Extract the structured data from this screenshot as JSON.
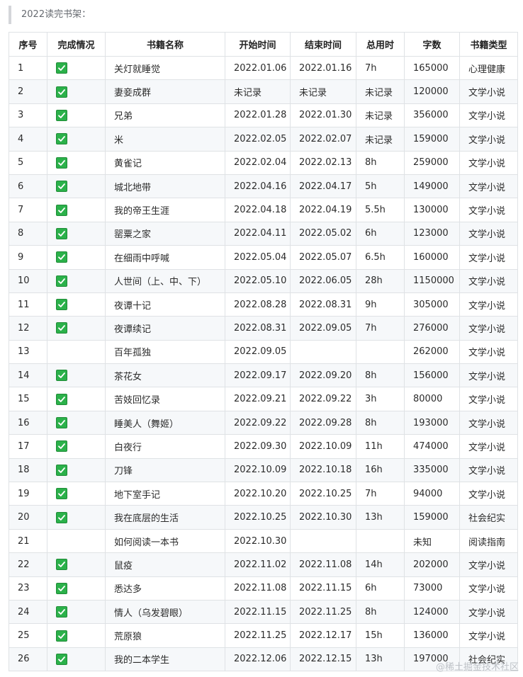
{
  "heading": "2022读完书架：",
  "columns": [
    "序号",
    "完成情况",
    "书籍名称",
    "开始时间",
    "结束时间",
    "总用时",
    "字数",
    "书籍类型"
  ],
  "rows": [
    {
      "no": "1",
      "done": true,
      "title": "关灯就睡觉",
      "start": "2022.01.06",
      "end": "2022.01.16",
      "time": "7h",
      "words": "165000",
      "type": "心理健康"
    },
    {
      "no": "2",
      "done": true,
      "title": "妻妾成群",
      "start": "未记录",
      "end": "未记录",
      "time": "未记录",
      "words": "120000",
      "type": "文学小说"
    },
    {
      "no": "3",
      "done": true,
      "title": "兄弟",
      "start": "2022.01.28",
      "end": "2022.01.30",
      "time": "未记录",
      "words": "356000",
      "type": "文学小说"
    },
    {
      "no": "4",
      "done": true,
      "title": "米",
      "start": "2022.02.05",
      "end": "2022.02.07",
      "time": "未记录",
      "words": "159000",
      "type": "文学小说"
    },
    {
      "no": "5",
      "done": true,
      "title": "黄雀记",
      "start": "2022.02.04",
      "end": "2022.02.13",
      "time": "8h",
      "words": "259000",
      "type": "文学小说"
    },
    {
      "no": "6",
      "done": true,
      "title": "城北地带",
      "start": "2022.04.16",
      "end": "2022.04.17",
      "time": "5h",
      "words": "149000",
      "type": "文学小说"
    },
    {
      "no": "7",
      "done": true,
      "title": "我的帝王生涯",
      "start": "2022.04.18",
      "end": "2022.04.19",
      "time": "5.5h",
      "words": "130000",
      "type": "文学小说"
    },
    {
      "no": "8",
      "done": true,
      "title": "罂粟之家",
      "start": "2022.04.11",
      "end": "2022.05.02",
      "time": "6h",
      "words": "123000",
      "type": "文学小说"
    },
    {
      "no": "9",
      "done": true,
      "title": "在细雨中呼喊",
      "start": "2022.05.04",
      "end": "2022.05.07",
      "time": "6.5h",
      "words": "160000",
      "type": "文学小说"
    },
    {
      "no": "10",
      "done": true,
      "title": "人世间（上、中、下）",
      "start": "2022.05.10",
      "end": "2022.06.05",
      "time": "28h",
      "words": "1150000",
      "type": "文学小说"
    },
    {
      "no": "11",
      "done": true,
      "title": "夜谭十记",
      "start": "2022.08.28",
      "end": "2022.08.31",
      "time": "9h",
      "words": "305000",
      "type": "文学小说"
    },
    {
      "no": "12",
      "done": true,
      "title": "夜谭续记",
      "start": "2022.08.31",
      "end": "2022.09.05",
      "time": "7h",
      "words": "276000",
      "type": "文学小说"
    },
    {
      "no": "13",
      "done": false,
      "title": "百年孤独",
      "start": "2022.09.05",
      "end": "",
      "time": "",
      "words": "262000",
      "type": "文学小说"
    },
    {
      "no": "14",
      "done": true,
      "title": "茶花女",
      "start": "2022.09.17",
      "end": "2022.09.20",
      "time": "8h",
      "words": "156000",
      "type": "文学小说"
    },
    {
      "no": "15",
      "done": true,
      "title": "苦妓回忆录",
      "start": "2022.09.21",
      "end": "2022.09.22",
      "time": "3h",
      "words": "80000",
      "type": "文学小说"
    },
    {
      "no": "16",
      "done": true,
      "title": "睡美人（舞姬）",
      "start": "2022.09.22",
      "end": "2022.09.28",
      "time": "8h",
      "words": "193000",
      "type": "文学小说"
    },
    {
      "no": "17",
      "done": true,
      "title": "白夜行",
      "start": "2022.09.30",
      "end": "2022.10.09",
      "time": "11h",
      "words": "474000",
      "type": "文学小说"
    },
    {
      "no": "18",
      "done": true,
      "title": "刀锋",
      "start": "2022.10.09",
      "end": "2022.10.18",
      "time": "16h",
      "words": "335000",
      "type": "文学小说"
    },
    {
      "no": "19",
      "done": true,
      "title": "地下室手记",
      "start": "2022.10.20",
      "end": "2022.10.25",
      "time": "7h",
      "words": "94000",
      "type": "文学小说"
    },
    {
      "no": "20",
      "done": true,
      "title": "我在底层的生活",
      "start": "2022.10.25",
      "end": "2022.10.30",
      "time": "13h",
      "words": "159000",
      "type": "社会纪实"
    },
    {
      "no": "21",
      "done": false,
      "title": "如何阅读一本书",
      "start": "2022.10.30",
      "end": "",
      "time": "",
      "words": "未知",
      "type": "阅读指南"
    },
    {
      "no": "22",
      "done": true,
      "title": "鼠疫",
      "start": "2022.11.02",
      "end": "2022.11.08",
      "time": "14h",
      "words": "202000",
      "type": "文学小说"
    },
    {
      "no": "23",
      "done": true,
      "title": "悉达多",
      "start": "2022.11.08",
      "end": "2022.11.15",
      "time": "6h",
      "words": "73000",
      "type": "文学小说"
    },
    {
      "no": "24",
      "done": true,
      "title": "情人（乌发碧眼）",
      "start": "2022.11.15",
      "end": "2022.11.25",
      "time": "8h",
      "words": "124000",
      "type": "文学小说"
    },
    {
      "no": "25",
      "done": true,
      "title": "荒原狼",
      "start": "2022.11.25",
      "end": "2022.12.17",
      "time": "15h",
      "words": "136000",
      "type": "文学小说"
    },
    {
      "no": "26",
      "done": true,
      "title": "我的二本学生",
      "start": "2022.12.06",
      "end": "2022.12.15",
      "time": "13h",
      "words": "197000",
      "type": "社会纪实"
    }
  ],
  "icons": {
    "done": "check-box-icon"
  },
  "colors": {
    "check": "#2bb14a",
    "stripe": "#f6f8fa",
    "border": "#dfe2e5"
  },
  "watermark": "@稀土掘金技术社区"
}
